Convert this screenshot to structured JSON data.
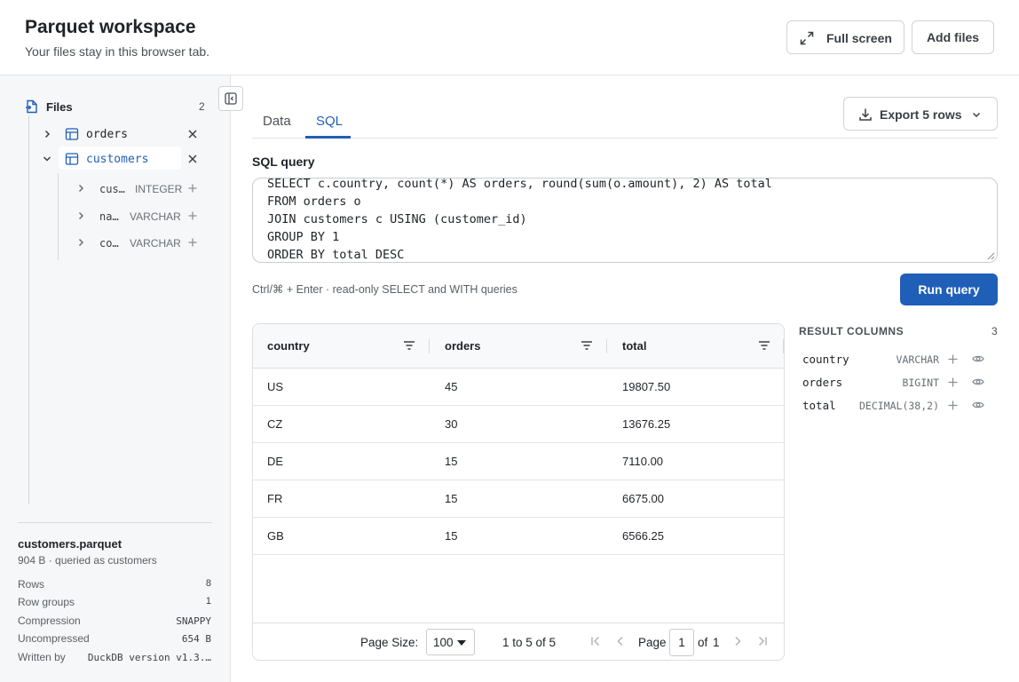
{
  "header": {
    "title": "Parquet workspace",
    "subtitle": "Your files stay in this browser tab.",
    "fullscreen_label": "Full screen",
    "addfiles_label": "Add files"
  },
  "sidebar": {
    "files_label": "Files",
    "files_count": "2",
    "files": [
      {
        "name": "orders",
        "expanded": false
      },
      {
        "name": "customers",
        "expanded": true
      }
    ],
    "columns": [
      {
        "name": "cus…",
        "type": "INTEGER"
      },
      {
        "name": "na…",
        "type": "VARCHAR"
      },
      {
        "name": "co…",
        "type": "VARCHAR"
      }
    ],
    "meta": {
      "file_name": "customers.parquet",
      "subline": "904 B · queried as customers",
      "rows": [
        {
          "key": "Rows",
          "value": "8"
        },
        {
          "key": "Row groups",
          "value": "1"
        },
        {
          "key": "Compression",
          "value": "SNAPPY"
        },
        {
          "key": "Uncompressed",
          "value": "654 B"
        },
        {
          "key": "Written by",
          "value": "DuckDB version v1.3.…"
        }
      ]
    }
  },
  "tabs": [
    {
      "label": "Data",
      "active": false
    },
    {
      "label": "SQL",
      "active": true
    }
  ],
  "export_label": "Export 5 rows",
  "sql": {
    "label": "SQL query",
    "lines": [
      "SELECT c.country, count(*) AS orders, round(sum(o.amount), 2) AS total",
      "FROM orders o",
      "JOIN customers c USING (customer_id)",
      "GROUP BY 1",
      "ORDER BY total DESC"
    ],
    "hint": "Ctrl/⌘ + Enter · read-only SELECT and WITH queries",
    "run_label": "Run query"
  },
  "grid": {
    "columns": [
      "country",
      "orders",
      "total"
    ],
    "rows": [
      [
        "US",
        "45",
        "19807.50"
      ],
      [
        "CZ",
        "30",
        "13676.25"
      ],
      [
        "DE",
        "15",
        "7110.00"
      ],
      [
        "FR",
        "15",
        "6675.00"
      ],
      [
        "GB",
        "15",
        "6566.25"
      ]
    ],
    "footer": {
      "page_size_label": "Page Size:",
      "page_size_value": "100",
      "range": "1 to 5 of 5",
      "page_label": "Page",
      "page_value": "1",
      "of_label": "of",
      "total_pages": "1"
    }
  },
  "result_columns": {
    "title": "RESULT COLUMNS",
    "count": "3",
    "items": [
      {
        "name": "country",
        "type": "VARCHAR"
      },
      {
        "name": "orders",
        "type": "BIGINT"
      },
      {
        "name": "total",
        "type": "DECIMAL(38,2)"
      }
    ]
  },
  "colors": {
    "accent": "#1f5fb8",
    "sidebar_bg": "#f6f7f8"
  }
}
